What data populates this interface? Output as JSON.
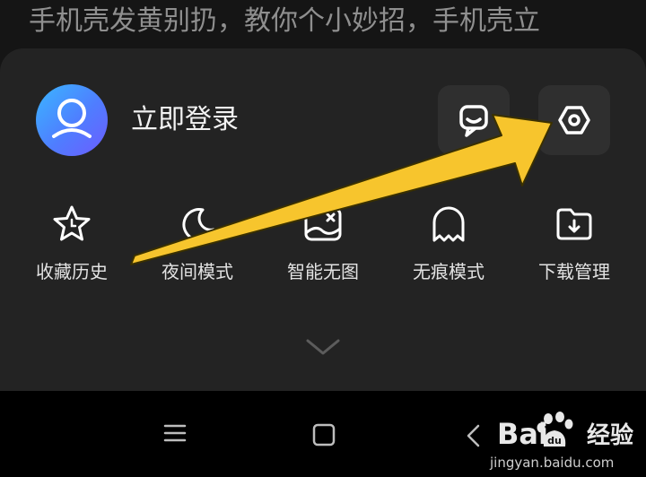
{
  "headline": "手机壳发黄别扔，教你个小妙招，手机壳立",
  "account": {
    "login_label": "立即登录"
  },
  "header_buttons": [
    {
      "name": "message-button",
      "icon": "chat-bubble-icon"
    },
    {
      "name": "settings-button",
      "icon": "hexagon-settings-icon"
    }
  ],
  "tools": [
    {
      "label": "收藏历史",
      "icon": "star-icon"
    },
    {
      "label": "夜间模式",
      "icon": "moon-icon"
    },
    {
      "label": "智能无图",
      "icon": "no-image-icon"
    },
    {
      "label": "无痕模式",
      "icon": "ghost-icon"
    },
    {
      "label": "下载管理",
      "icon": "download-folder-icon"
    }
  ],
  "collapse": {
    "icon": "chevron-down-icon"
  },
  "navbar": {
    "icons": [
      "menu-icon",
      "home-square-icon",
      "back-icon"
    ]
  },
  "watermark": {
    "brand": "Bai",
    "brand_cn": "经验",
    "url": "jingyan.baidu.com"
  },
  "colors": {
    "panel": "#232323",
    "arrow": "#f7c52d",
    "avatar_from": "#3ab7ff",
    "avatar_to": "#6d5cff"
  }
}
